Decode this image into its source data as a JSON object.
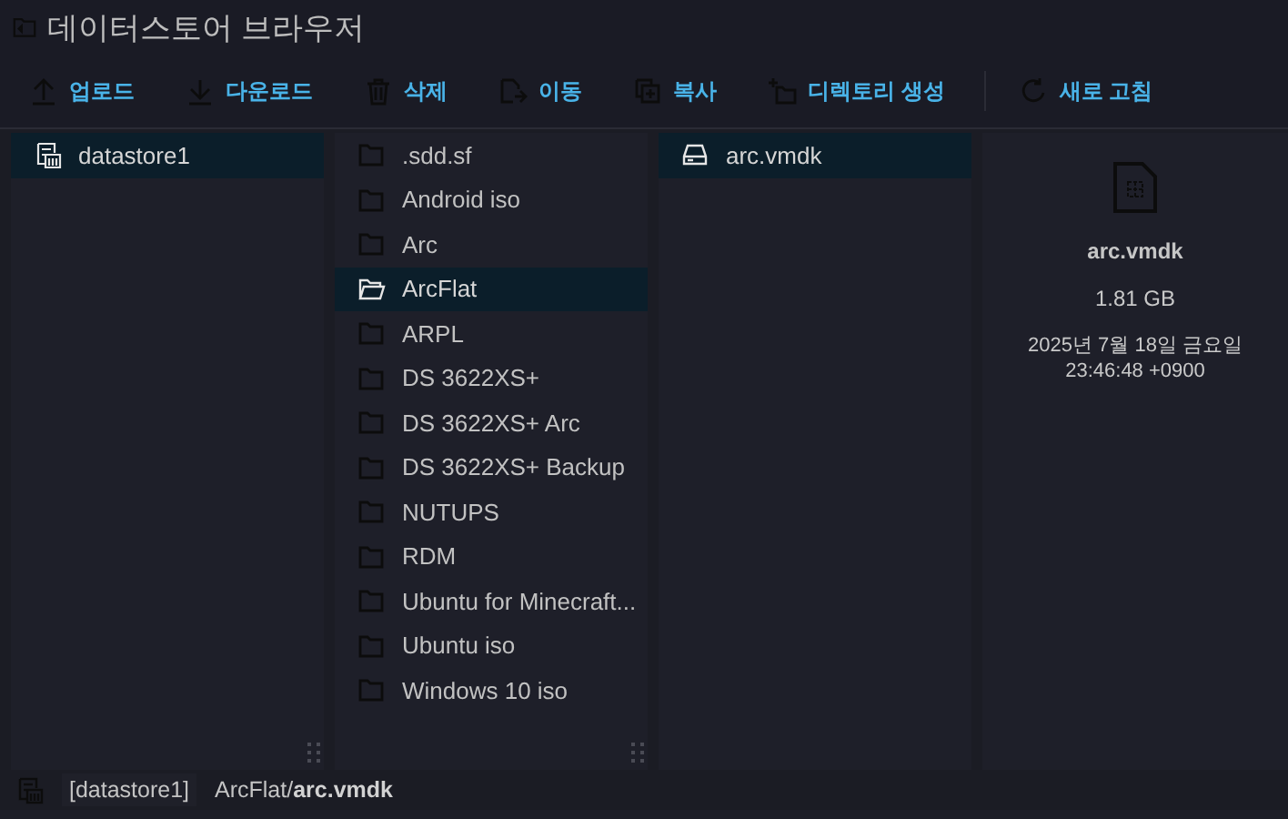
{
  "window": {
    "title": "데이터스토어 브라우저"
  },
  "toolbar": [
    {
      "label": "업로드",
      "kind": "upload"
    },
    {
      "label": "다운로드",
      "kind": "download"
    },
    {
      "label": "삭제",
      "kind": "delete"
    },
    {
      "label": "이동",
      "kind": "move"
    },
    {
      "label": "복사",
      "kind": "copy"
    },
    {
      "label": "디렉토리 생성",
      "kind": "mkdir"
    },
    {
      "label": "새로 고침",
      "kind": "refresh"
    }
  ],
  "columns": [
    {
      "items": [
        {
          "name": "datastore1",
          "kind": "datastore",
          "selected": true
        }
      ]
    },
    {
      "items": [
        {
          "name": ".sdd.sf",
          "kind": "folder",
          "selected": false
        },
        {
          "name": "Android iso",
          "kind": "folder",
          "selected": false
        },
        {
          "name": "Arc",
          "kind": "folder",
          "selected": false
        },
        {
          "name": "ArcFlat",
          "kind": "folder",
          "selected": true
        },
        {
          "name": "ARPL",
          "kind": "folder",
          "selected": false
        },
        {
          "name": "DS 3622XS+",
          "kind": "folder",
          "selected": false
        },
        {
          "name": "DS 3622XS+ Arc",
          "kind": "folder",
          "selected": false
        },
        {
          "name": "DS 3622XS+ Backup",
          "kind": "folder",
          "selected": false
        },
        {
          "name": "NUTUPS",
          "kind": "folder",
          "selected": false
        },
        {
          "name": "RDM",
          "kind": "folder",
          "selected": false
        },
        {
          "name": "Ubuntu for Minecraft...",
          "kind": "folder",
          "selected": false
        },
        {
          "name": "Ubuntu iso",
          "kind": "folder",
          "selected": false
        },
        {
          "name": "Windows 10 iso",
          "kind": "folder",
          "selected": false
        }
      ]
    },
    {
      "items": [
        {
          "name": "arc.vmdk",
          "kind": "disk",
          "selected": true
        }
      ]
    }
  ],
  "details": {
    "name": "arc.vmdk",
    "size": "1.81 GB",
    "modified": "2025년 7월 18일 금요일 23:46:48 +0900"
  },
  "status_bar": {
    "datastore": "[datastore1]",
    "folder": "ArcFlat/",
    "file": "arc.vmdk"
  }
}
